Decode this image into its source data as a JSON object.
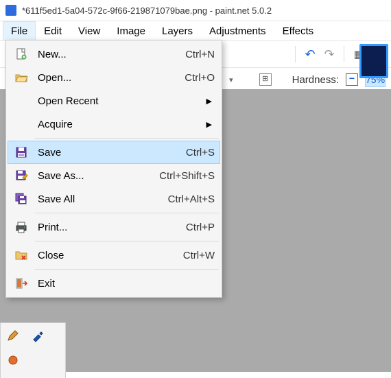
{
  "title": "*611f5ed1-5a04-572c-9f66-219871079bae.png - paint.net 5.0.2",
  "menubar": [
    "File",
    "Edit",
    "View",
    "Image",
    "Layers",
    "Adjustments",
    "Effects"
  ],
  "menubar_open_index": 0,
  "toolbar2": {
    "hardness_label": "Hardness:",
    "hardness_value": "75%"
  },
  "file_menu": [
    {
      "icon": "new",
      "label": "New...",
      "shortcut": "Ctrl+N"
    },
    {
      "icon": "open",
      "label": "Open...",
      "shortcut": "Ctrl+O"
    },
    {
      "icon": "",
      "label": "Open Recent",
      "submenu": true
    },
    {
      "icon": "",
      "label": "Acquire",
      "submenu": true
    },
    {
      "sep": true
    },
    {
      "icon": "save",
      "label": "Save",
      "shortcut": "Ctrl+S",
      "highlight": true
    },
    {
      "icon": "saveas",
      "label": "Save As...",
      "shortcut": "Ctrl+Shift+S"
    },
    {
      "icon": "saveall",
      "label": "Save All",
      "shortcut": "Ctrl+Alt+S"
    },
    {
      "sep": true
    },
    {
      "icon": "print",
      "label": "Print...",
      "shortcut": "Ctrl+P"
    },
    {
      "sep": true
    },
    {
      "icon": "close",
      "label": "Close",
      "shortcut": "Ctrl+W"
    },
    {
      "sep": true
    },
    {
      "icon": "exit",
      "label": "Exit"
    }
  ]
}
